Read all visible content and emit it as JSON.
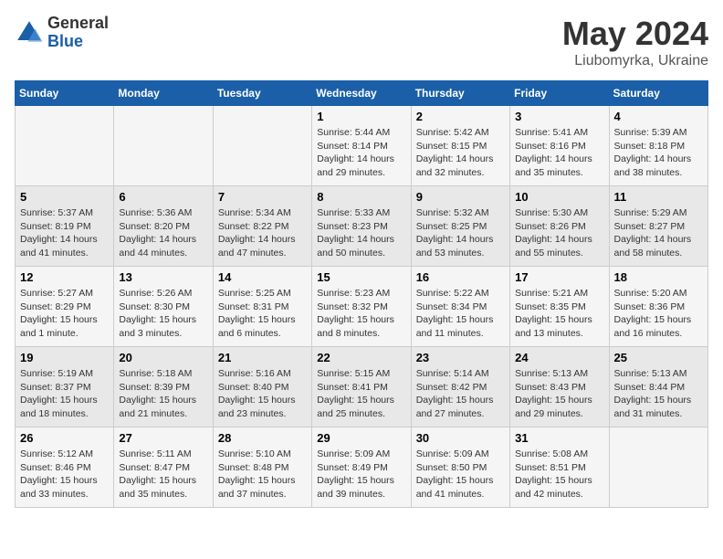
{
  "header": {
    "logo_general": "General",
    "logo_blue": "Blue",
    "title": "May 2024",
    "location": "Liubomyrka, Ukraine"
  },
  "days_of_week": [
    "Sunday",
    "Monday",
    "Tuesday",
    "Wednesday",
    "Thursday",
    "Friday",
    "Saturday"
  ],
  "weeks": [
    [
      {
        "day": "",
        "info": ""
      },
      {
        "day": "",
        "info": ""
      },
      {
        "day": "",
        "info": ""
      },
      {
        "day": "1",
        "info": "Sunrise: 5:44 AM\nSunset: 8:14 PM\nDaylight: 14 hours\nand 29 minutes."
      },
      {
        "day": "2",
        "info": "Sunrise: 5:42 AM\nSunset: 8:15 PM\nDaylight: 14 hours\nand 32 minutes."
      },
      {
        "day": "3",
        "info": "Sunrise: 5:41 AM\nSunset: 8:16 PM\nDaylight: 14 hours\nand 35 minutes."
      },
      {
        "day": "4",
        "info": "Sunrise: 5:39 AM\nSunset: 8:18 PM\nDaylight: 14 hours\nand 38 minutes."
      }
    ],
    [
      {
        "day": "5",
        "info": "Sunrise: 5:37 AM\nSunset: 8:19 PM\nDaylight: 14 hours\nand 41 minutes."
      },
      {
        "day": "6",
        "info": "Sunrise: 5:36 AM\nSunset: 8:20 PM\nDaylight: 14 hours\nand 44 minutes."
      },
      {
        "day": "7",
        "info": "Sunrise: 5:34 AM\nSunset: 8:22 PM\nDaylight: 14 hours\nand 47 minutes."
      },
      {
        "day": "8",
        "info": "Sunrise: 5:33 AM\nSunset: 8:23 PM\nDaylight: 14 hours\nand 50 minutes."
      },
      {
        "day": "9",
        "info": "Sunrise: 5:32 AM\nSunset: 8:25 PM\nDaylight: 14 hours\nand 53 minutes."
      },
      {
        "day": "10",
        "info": "Sunrise: 5:30 AM\nSunset: 8:26 PM\nDaylight: 14 hours\nand 55 minutes."
      },
      {
        "day": "11",
        "info": "Sunrise: 5:29 AM\nSunset: 8:27 PM\nDaylight: 14 hours\nand 58 minutes."
      }
    ],
    [
      {
        "day": "12",
        "info": "Sunrise: 5:27 AM\nSunset: 8:29 PM\nDaylight: 15 hours\nand 1 minute."
      },
      {
        "day": "13",
        "info": "Sunrise: 5:26 AM\nSunset: 8:30 PM\nDaylight: 15 hours\nand 3 minutes."
      },
      {
        "day": "14",
        "info": "Sunrise: 5:25 AM\nSunset: 8:31 PM\nDaylight: 15 hours\nand 6 minutes."
      },
      {
        "day": "15",
        "info": "Sunrise: 5:23 AM\nSunset: 8:32 PM\nDaylight: 15 hours\nand 8 minutes."
      },
      {
        "day": "16",
        "info": "Sunrise: 5:22 AM\nSunset: 8:34 PM\nDaylight: 15 hours\nand 11 minutes."
      },
      {
        "day": "17",
        "info": "Sunrise: 5:21 AM\nSunset: 8:35 PM\nDaylight: 15 hours\nand 13 minutes."
      },
      {
        "day": "18",
        "info": "Sunrise: 5:20 AM\nSunset: 8:36 PM\nDaylight: 15 hours\nand 16 minutes."
      }
    ],
    [
      {
        "day": "19",
        "info": "Sunrise: 5:19 AM\nSunset: 8:37 PM\nDaylight: 15 hours\nand 18 minutes."
      },
      {
        "day": "20",
        "info": "Sunrise: 5:18 AM\nSunset: 8:39 PM\nDaylight: 15 hours\nand 21 minutes."
      },
      {
        "day": "21",
        "info": "Sunrise: 5:16 AM\nSunset: 8:40 PM\nDaylight: 15 hours\nand 23 minutes."
      },
      {
        "day": "22",
        "info": "Sunrise: 5:15 AM\nSunset: 8:41 PM\nDaylight: 15 hours\nand 25 minutes."
      },
      {
        "day": "23",
        "info": "Sunrise: 5:14 AM\nSunset: 8:42 PM\nDaylight: 15 hours\nand 27 minutes."
      },
      {
        "day": "24",
        "info": "Sunrise: 5:13 AM\nSunset: 8:43 PM\nDaylight: 15 hours\nand 29 minutes."
      },
      {
        "day": "25",
        "info": "Sunrise: 5:13 AM\nSunset: 8:44 PM\nDaylight: 15 hours\nand 31 minutes."
      }
    ],
    [
      {
        "day": "26",
        "info": "Sunrise: 5:12 AM\nSunset: 8:46 PM\nDaylight: 15 hours\nand 33 minutes."
      },
      {
        "day": "27",
        "info": "Sunrise: 5:11 AM\nSunset: 8:47 PM\nDaylight: 15 hours\nand 35 minutes."
      },
      {
        "day": "28",
        "info": "Sunrise: 5:10 AM\nSunset: 8:48 PM\nDaylight: 15 hours\nand 37 minutes."
      },
      {
        "day": "29",
        "info": "Sunrise: 5:09 AM\nSunset: 8:49 PM\nDaylight: 15 hours\nand 39 minutes."
      },
      {
        "day": "30",
        "info": "Sunrise: 5:09 AM\nSunset: 8:50 PM\nDaylight: 15 hours\nand 41 minutes."
      },
      {
        "day": "31",
        "info": "Sunrise: 5:08 AM\nSunset: 8:51 PM\nDaylight: 15 hours\nand 42 minutes."
      },
      {
        "day": "",
        "info": ""
      }
    ]
  ]
}
